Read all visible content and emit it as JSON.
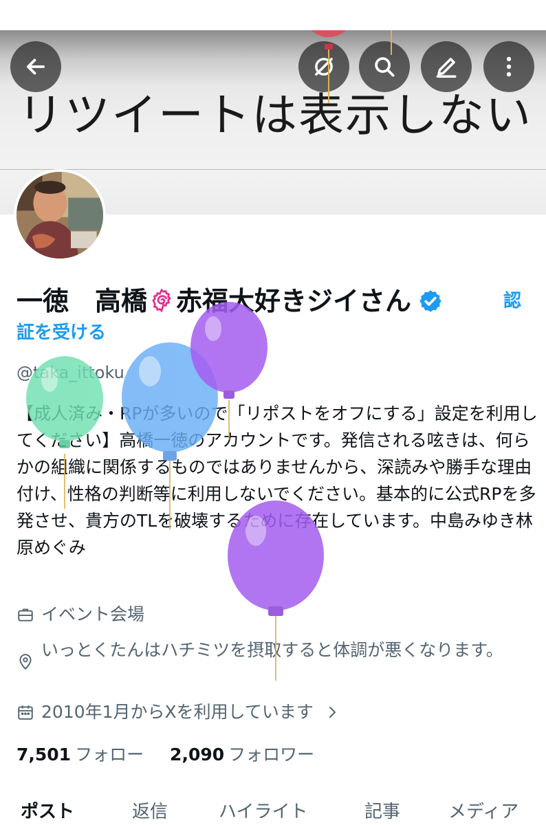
{
  "header": {
    "banner_text": "リツイートは表示しない"
  },
  "nav_icons": [
    "back-arrow-icon",
    "grok-icon",
    "search-icon",
    "edit-icon",
    "more-icon"
  ],
  "profile": {
    "name_part1": "一徳　高橋",
    "name_part2": "赤福大好きジイさん",
    "verify_link_line1": "認",
    "verify_link_line2": "証を受ける",
    "handle": "@taka_ittoku",
    "bio": "【成人済み・RPが多いので「リポストをオフにする」設定を利用してください】高橋一徳のアカウントです。発信される呟きは、何らかの組織に関係するものではありませんから、深読みや勝手な理由付け、性格の判断等に利用しないでください。基本的に公式RPを多発させ、貴方のTLを破壊するために存在しています。中島みゆき林原めぐみ",
    "category": "イベント会場",
    "location": "いっとくたんはハチミツを摂取すると体調が悪くなります。",
    "joined": "2010年1月からXを利用しています",
    "following_count": "7,501",
    "following_label": "フォロー",
    "followers_count": "2,090",
    "followers_label": "フォロワー"
  },
  "tabs": [
    "ポスト",
    "返信",
    "ハイライト",
    "記事",
    "メディア"
  ],
  "colors": {
    "accent": "#1d9bf0",
    "secondary_text": "#536471",
    "balloon_green": "#6fe0b0",
    "balloon_blue": "#6aaef6",
    "balloon_purple": "#a45ef0",
    "balloon_red": "#e04a5a"
  }
}
